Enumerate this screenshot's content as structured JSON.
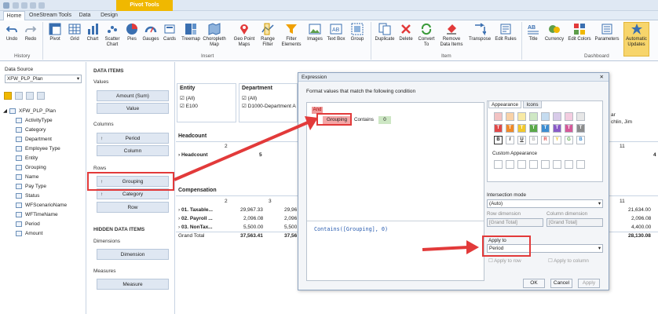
{
  "titlebar": {
    "context_tab": "Pivot Tools"
  },
  "tabs": [
    "Home",
    "OneStream Tools",
    "Data",
    "Design"
  ],
  "ribbon": {
    "buttons": [
      "Undo",
      "Redo",
      "Pivot",
      "Grid",
      "Chart",
      "Scatter Chart",
      "Pies",
      "Gauges",
      "Cards",
      "Treemap",
      "Choropleth Map",
      "Geo Point Maps",
      "Range Filter",
      "Filter Elements",
      "Images",
      "Text Box",
      "Group",
      "Duplicate",
      "Delete",
      "Convert To",
      "Remove Data Items",
      "Transpose",
      "Edit Rules",
      "Title",
      "Currency",
      "Edit Colors",
      "Parameters",
      "Automatic Updates"
    ],
    "groups": {
      "history": "History",
      "insert": "Insert",
      "item": "Item",
      "dashboard": "Dashboard"
    }
  },
  "left": {
    "data_source_label": "Data Source",
    "data_source_value": "XFW_PLP_Plan",
    "root": "XFW_PLP_Plan",
    "fields": [
      "ActivityType",
      "Category",
      "Department",
      "Employee Type",
      "Entity",
      "Grouping",
      "Name",
      "Pay Type",
      "Status",
      "WFScenarioName",
      "WFTimeName",
      "Period",
      "Amount"
    ]
  },
  "data_items": {
    "title": "DATA ITEMS",
    "values_label": "Values",
    "values": [
      "Amount (Sum)",
      "Value"
    ],
    "columns_label": "Columns",
    "columns": [
      "Period",
      "Column"
    ],
    "rows_label": "Rows",
    "rows": [
      "Grouping",
      "Category",
      "Row"
    ],
    "hidden_title": "HIDDEN DATA ITEMS",
    "dimensions_label": "Dimensions",
    "dimensions": "Dimension",
    "measures_label": "Measures",
    "measures": "Measure"
  },
  "grid": {
    "entity_header": "Entity",
    "entity_items": [
      "(All)",
      "E100"
    ],
    "department_header": "Department",
    "department_items": [
      "(All)",
      "D1000-Department A"
    ],
    "right_text": [
      "ar",
      "chlin, Jim"
    ],
    "headcount_title": "Headcount",
    "headcount_col": "2",
    "headcount_col11": "11",
    "headcount_row": "Headcount",
    "headcount_val": "5",
    "headcount_val11": "4",
    "comp_title": "Compensation",
    "comp_cols": [
      "2",
      "3",
      "11"
    ],
    "comp_rows": [
      {
        "label": "01. Taxable...",
        "c2": "29,967.33",
        "c3": "29,96",
        "c11": "21,634.00"
      },
      {
        "label": "02. Payroll ...",
        "c2": "2,096.08",
        "c3": "2,096",
        "c11": "2,096.08"
      },
      {
        "label": "03. NonTax...",
        "c2": "5,500.00",
        "c3": "5,500",
        "c11": "4,400.00"
      },
      {
        "label": "Grand Total",
        "c2": "37,563.41",
        "c3": "37,56",
        "c11": "28,130.08"
      }
    ]
  },
  "dialog": {
    "title": "Expression",
    "subtitle": "Format values that match the following condition",
    "and_label": "And",
    "cond_field": "Grouping",
    "cond_op": "Contains",
    "cond_value": "0",
    "expression": "Contains([Grouping], 0)",
    "tab_appearance": "Appearance",
    "tab_icons": "Icons",
    "custom_appearance": "Custom Appearance",
    "intersection_label": "Intersection mode",
    "intersection_value": "(Auto)",
    "row_dim_label": "Row dimension",
    "row_dim_value": "[Grand Total]",
    "col_dim_label": "Column dimension",
    "col_dim_value": "[Grand Total]",
    "apply_to_label": "Apply to",
    "apply_to_value": "Period",
    "apply_row": "Apply to row",
    "apply_col": "Apply to column",
    "ok": "OK",
    "cancel": "Cancel",
    "apply": "Apply"
  },
  "colors": {
    "accent": "#e23a3a",
    "context_tab": "#f0b800"
  }
}
